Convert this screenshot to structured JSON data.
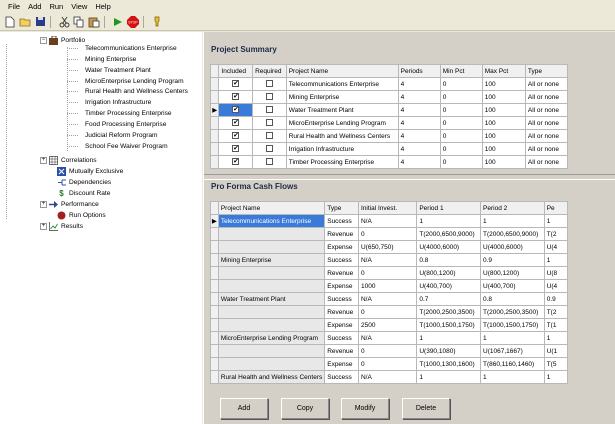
{
  "menu": [
    "File",
    "Add",
    "Run",
    "View",
    "Help"
  ],
  "toolbar_icons": [
    "new-icon",
    "open-icon",
    "save-icon",
    "cut-icon",
    "copy-icon",
    "paste-icon",
    "run-icon",
    "stop-icon",
    "help-icon"
  ],
  "tree": {
    "portfolio": "Portfolio",
    "projects": [
      "Telecommunications Enterprise",
      "Mining Enterprise",
      "Water Treatment Plant",
      "MicroEnterprise Lending Program",
      "Rural Health and Wellness Centers",
      "Irrigation Infrastructure",
      "Timber Processing Enterprise",
      "Food Processing Enterprise",
      "Judicial Reform Program",
      "School Fee Waiver Program"
    ],
    "correlations": "Correlations",
    "mutually_exclusive": "Mutually Exclusive",
    "dependencies": "Dependencies",
    "discount_rate": "Discount Rate",
    "performance": "Performance",
    "run_options": "Run Options",
    "results": "Results"
  },
  "summary": {
    "title": "Project Summary",
    "headers": [
      "Included",
      "Required",
      "Project Name",
      "Periods",
      "Min Pct",
      "Max Pct",
      "Type"
    ],
    "rows": [
      {
        "included": true,
        "required": false,
        "name": "Telecommunications Enterprise",
        "periods": "4",
        "min": "0",
        "max": "100",
        "type": "All or none"
      },
      {
        "included": true,
        "required": false,
        "name": "Mining Enterprise",
        "periods": "4",
        "min": "0",
        "max": "100",
        "type": "All or none"
      },
      {
        "included": true,
        "required": false,
        "name": "Water Treatment Plant",
        "periods": "4",
        "min": "0",
        "max": "100",
        "type": "All or none"
      },
      {
        "included": true,
        "required": false,
        "name": "MicroEnterprise Lending Program",
        "periods": "4",
        "min": "0",
        "max": "100",
        "type": "All or none"
      },
      {
        "included": true,
        "required": false,
        "name": "Rural Health and Wellness Centers",
        "periods": "4",
        "min": "0",
        "max": "100",
        "type": "All or none"
      },
      {
        "included": true,
        "required": false,
        "name": "Irrigation Infrastructure",
        "periods": "4",
        "min": "0",
        "max": "100",
        "type": "All or none"
      },
      {
        "included": true,
        "required": false,
        "name": "Timber Processing Enterprise",
        "periods": "4",
        "min": "0",
        "max": "100",
        "type": "All or none"
      }
    ]
  },
  "cashflows": {
    "title": "Pro Forma Cash Flows",
    "headers": [
      "Project Name",
      "Type",
      "Initial Invest.",
      "Period 1",
      "Period 2",
      "Pe"
    ],
    "rows": [
      {
        "name": "Telecommunications Enterprise",
        "type": "Success",
        "init": "N/A",
        "p1": "1",
        "p2": "1",
        "p3": "1"
      },
      {
        "name": "",
        "type": "Revenue",
        "init": "0",
        "p1": "T(2000,6500,9000)",
        "p2": "T(2000,6500,9000)",
        "p3": "T(2"
      },
      {
        "name": "",
        "type": "Expense",
        "init": "U(650,750)",
        "p1": "U(4000,6000)",
        "p2": "U(4000,6000)",
        "p3": "U(4"
      },
      {
        "name": "Mining Enterprise",
        "type": "Success",
        "init": "N/A",
        "p1": "0.8",
        "p2": "0.9",
        "p3": "1"
      },
      {
        "name": "",
        "type": "Revenue",
        "init": "0",
        "p1": "U(800,1200)",
        "p2": "U(800,1200)",
        "p3": "U(8"
      },
      {
        "name": "",
        "type": "Expense",
        "init": "1000",
        "p1": "U(400,700)",
        "p2": "U(400,700)",
        "p3": "U(4"
      },
      {
        "name": "Water Treatment Plant",
        "type": "Success",
        "init": "N/A",
        "p1": "0.7",
        "p2": "0.8",
        "p3": "0.9"
      },
      {
        "name": "",
        "type": "Revenue",
        "init": "0",
        "p1": "T(2000,2500,3500)",
        "p2": "T(2000,2500,3500)",
        "p3": "T(2"
      },
      {
        "name": "",
        "type": "Expense",
        "init": "2500",
        "p1": "T(1000,1500,1750)",
        "p2": "T(1000,1500,1750)",
        "p3": "T(1"
      },
      {
        "name": "MicroEnterprise Lending Program",
        "type": "Success",
        "init": "N/A",
        "p1": "1",
        "p2": "1",
        "p3": "1"
      },
      {
        "name": "",
        "type": "Revenue",
        "init": "0",
        "p1": "U(390,1080)",
        "p2": "U(1067,1667)",
        "p3": "U(1"
      },
      {
        "name": "",
        "type": "Expense",
        "init": "0",
        "p1": "T(1000,1300,1600)",
        "p2": "T(860,1160,1460)",
        "p3": "T(5"
      },
      {
        "name": "Rural Health and Wellness Centers",
        "type": "Success",
        "init": "N/A",
        "p1": "1",
        "p2": "1",
        "p3": "1"
      }
    ]
  },
  "buttons": {
    "add": "Add",
    "copy": "Copy",
    "modify": "Modify",
    "delete": "Delete"
  }
}
